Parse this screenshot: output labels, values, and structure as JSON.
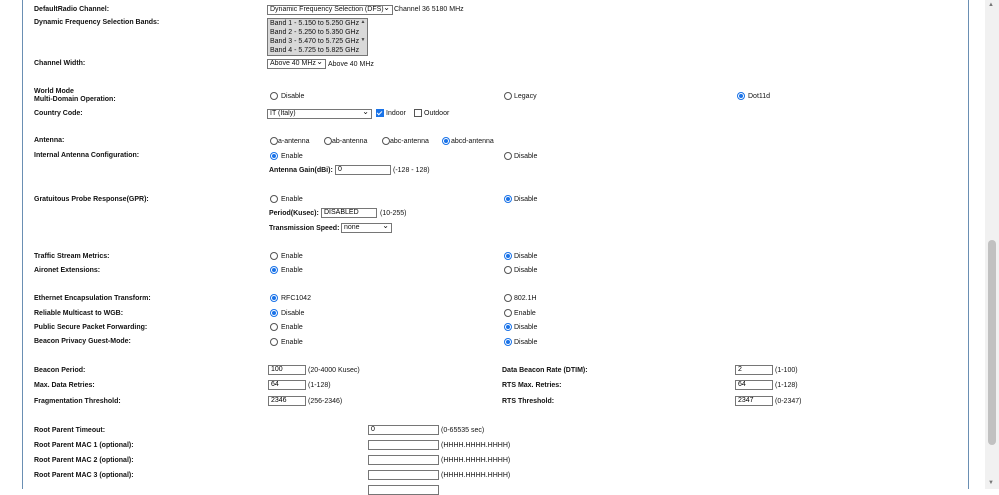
{
  "rows": {
    "default_radio_channel": {
      "label": "DefaultRadio Channel:",
      "select": "Dynamic Frequency Selection (DFS)",
      "note": "Channel 36 5180 MHz"
    },
    "dfs_bands": {
      "label": "Dynamic Frequency Selection Bands:",
      "options": [
        "Band 1 - 5.150 to 5.250 GHz",
        "Band 2 - 5.250 to 5.350 GHz",
        "Band 3 - 5.470 to 5.725 GHz",
        "Band 4 - 5.725 to 5.825 GHz"
      ]
    },
    "channel_width": {
      "label": "Channel Width:",
      "select": "Above 40 MHz",
      "note": "Above 40 MHz"
    },
    "world_mode": {
      "label1": "World Mode",
      "label2": "Multi-Domain Operation:",
      "opt_disable": "Disable",
      "opt_legacy": "Legacy",
      "opt_dot11d": "Dot11d",
      "selected": "Dot11d"
    },
    "country_code": {
      "label": "Country Code:",
      "select": "IT (Italy)",
      "indoor": "Indoor",
      "outdoor": "Outdoor",
      "indoor_checked": true,
      "outdoor_checked": false
    },
    "antenna": {
      "label": "Antenna:",
      "opts": [
        "a-antenna",
        "ab-antenna",
        "abc-antenna",
        "abcd-antenna"
      ],
      "selected": "abcd-antenna"
    },
    "internal_antenna": {
      "label": "Internal Antenna Configuration:",
      "enable": "Enable",
      "disable": "Disable",
      "selected": "Enable",
      "gain_label": "Antenna Gain(dBi):",
      "gain_value": "0",
      "gain_range": "(-128 - 128)"
    },
    "gpr": {
      "label": "Gratuitous Probe Response(GPR):",
      "enable": "Enable",
      "disable": "Disable",
      "selected": "Disable",
      "period_label": "Period(Kusec):",
      "period_value": "DISABLED",
      "period_range": "(10-255)",
      "speed_label": "Transmission Speed:",
      "speed_value": "none"
    },
    "traffic_stream": {
      "label": "Traffic Stream Metrics:",
      "enable": "Enable",
      "disable": "Disable",
      "selected": "Disable"
    },
    "aironet": {
      "label": "Aironet Extensions:",
      "enable": "Enable",
      "disable": "Disable",
      "selected": "Enable"
    },
    "eth_encap": {
      "label": "Ethernet Encapsulation Transform:",
      "opt1": "RFC1042",
      "opt2": "802.1H",
      "selected": "RFC1042"
    },
    "reliable_multicast": {
      "label": "Reliable Multicast to WGB:",
      "disable": "Disable",
      "enable": "Enable",
      "selected": "Disable"
    },
    "pspf": {
      "label": "Public Secure Packet Forwarding:",
      "enable": "Enable",
      "disable": "Disable",
      "selected": "Disable"
    },
    "beacon_privacy": {
      "label": "Beacon Privacy Guest-Mode:",
      "enable": "Enable",
      "disable": "Disable",
      "selected": "Disable"
    },
    "beacon_period": {
      "label": "Beacon Period:",
      "value": "100",
      "range": "(20-4000 Kusec)"
    },
    "dtim": {
      "label": "Data Beacon Rate (DTIM):",
      "value": "2",
      "range": "(1-100)"
    },
    "max_data_retries": {
      "label": "Max. Data Retries:",
      "value": "64",
      "range": "(1-128)"
    },
    "rts_max_retries": {
      "label": "RTS Max. Retries:",
      "value": "64",
      "range": "(1-128)"
    },
    "frag_threshold": {
      "label": "Fragmentation Threshold:",
      "value": "2346",
      "range": "(256-2346)"
    },
    "rts_threshold": {
      "label": "RTS Threshold:",
      "value": "2347",
      "range": "(0-2347)"
    },
    "root_parent_timeout": {
      "label": "Root Parent Timeout:",
      "value": "0",
      "range": "(0-65535 sec)"
    },
    "root_parent_mac1": {
      "label": "Root Parent MAC 1 (optional):",
      "value": "",
      "hint": "(HHHH.HHHH.HHHH)"
    },
    "root_parent_mac2": {
      "label": "Root Parent MAC 2 (optional):",
      "value": "",
      "hint": "(HHHH.HHHH.HHHH)"
    },
    "root_parent_mac3": {
      "label": "Root Parent MAC 3 (optional):",
      "value": "",
      "hint": "(HHHH.HHHH.HHHH)"
    }
  },
  "colors": {
    "accent": "#1a73e8",
    "frame": "#6a8fb3"
  }
}
